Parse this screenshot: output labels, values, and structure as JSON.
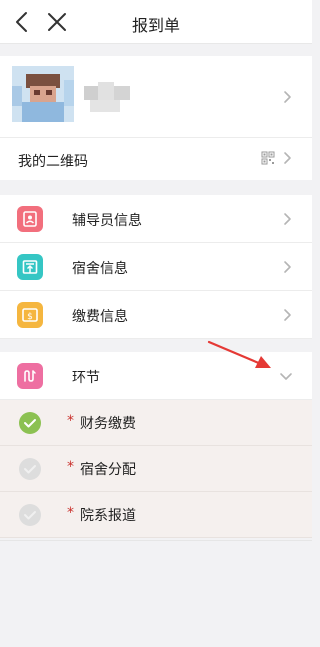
{
  "header": {
    "title": "报到单"
  },
  "profile": {
    "name_obscured": true
  },
  "qr_row": {
    "label": "我的二维码"
  },
  "menu": [
    {
      "label": "辅导员信息",
      "icon": "id-card-icon",
      "color": "#f26f7d"
    },
    {
      "label": "宿舍信息",
      "icon": "building-icon",
      "color": "#35c6c4"
    },
    {
      "label": "缴费信息",
      "icon": "payment-icon",
      "color": "#f5b63f"
    }
  ],
  "process": {
    "label": "环节",
    "icon": "route-icon",
    "color": "#ee6fa1"
  },
  "steps": [
    {
      "label": "财务缴费",
      "marker": "*",
      "status": "done",
      "status_color": "#8cc152"
    },
    {
      "label": "宿舍分配",
      "marker": "*",
      "status": "pending",
      "status_color": "#dddddd"
    },
    {
      "label": "院系报道",
      "marker": "*",
      "status": "pending",
      "status_color": "#dddddd"
    }
  ],
  "annotation": {
    "arrow_color": "#e53935"
  }
}
